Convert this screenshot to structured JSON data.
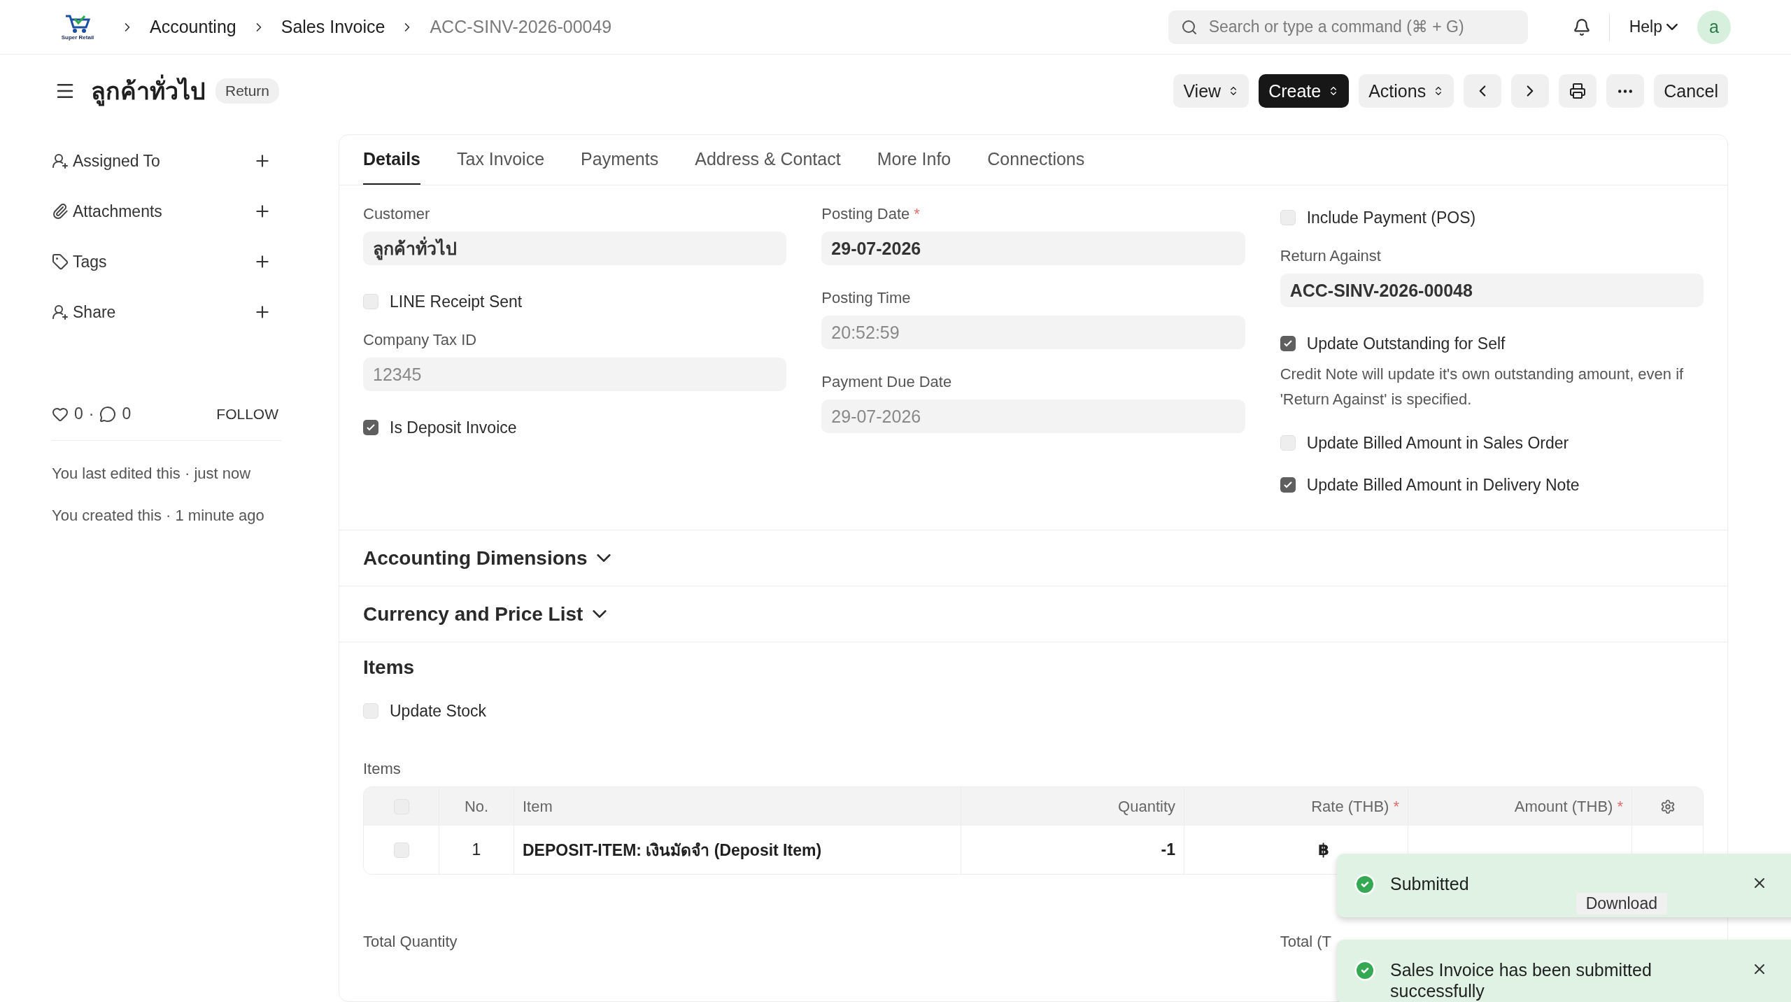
{
  "topbar": {
    "logo_text": "Super Retail",
    "breadcrumbs": [
      "Accounting",
      "Sales Invoice",
      "ACC-SINV-2026-00049"
    ],
    "search": {
      "placeholder": "Search or type a command (⌘ + G)"
    },
    "help": "Help",
    "avatar": "a"
  },
  "required_mark": "*",
  "header": {
    "title": "ลูกค้าทั่วไป",
    "status": "Return",
    "buttons": [
      {
        "kind": "dropdown",
        "label": "View"
      },
      {
        "kind": "primary",
        "label": "Create"
      },
      {
        "kind": "dropdown",
        "label": "Actions"
      },
      {
        "kind": "prev"
      },
      {
        "kind": "next"
      },
      {
        "kind": "print"
      },
      {
        "kind": "more"
      },
      {
        "kind": "plain",
        "label": "Cancel"
      }
    ]
  },
  "sidebar": {
    "items": [
      {
        "kind": "assign",
        "label": "Assigned To"
      },
      {
        "kind": "attach",
        "label": "Attachments"
      },
      {
        "kind": "tag",
        "label": "Tags"
      },
      {
        "kind": "share",
        "label": "Share"
      }
    ],
    "likes": "0",
    "separator": "·",
    "comments": "0",
    "follow": "FOLLOW",
    "activity": [
      "You last edited this · just now",
      "You created this · 1 minute ago"
    ]
  },
  "tabs": [
    {
      "label": "Details",
      "selected": true
    },
    {
      "label": "Tax Invoice",
      "selected": false
    },
    {
      "label": "Payments",
      "selected": false
    },
    {
      "label": "Address & Contact",
      "selected": false
    },
    {
      "label": "More Info",
      "selected": false
    },
    {
      "label": "Connections",
      "selected": false
    }
  ],
  "form": {
    "columns": [
      [
        {
          "kind": "field",
          "label": "Customer",
          "value": "ลูกค้าทั่วไป",
          "required": false,
          "strong": true
        },
        {
          "kind": "check",
          "label": "LINE Receipt Sent",
          "checked": false
        },
        {
          "kind": "field",
          "label": "Company Tax ID",
          "value": "12345",
          "required": false,
          "strong": false
        },
        {
          "kind": "check",
          "label": "Is Deposit Invoice",
          "checked": true
        }
      ],
      [
        {
          "kind": "field",
          "label": "Posting Date",
          "value": "29-07-2026",
          "required": true,
          "strong": true
        },
        {
          "kind": "field",
          "label": "Posting Time",
          "value": "20:52:59",
          "required": false,
          "strong": false
        },
        {
          "kind": "field",
          "label": "Payment Due Date",
          "value": "29-07-2026",
          "required": false,
          "strong": false
        }
      ],
      [
        {
          "kind": "check",
          "label": "Include Payment (POS)",
          "checked": false
        },
        {
          "kind": "field",
          "label": "Return Against",
          "value": "ACC-SINV-2026-00048",
          "required": false,
          "strong": true
        },
        {
          "kind": "check",
          "label": "Update Outstanding for Self",
          "checked": true
        },
        {
          "kind": "note",
          "text": "Credit Note will update it's own outstanding amount, even if 'Return Against' is specified."
        },
        {
          "kind": "check",
          "label": "Update Billed Amount in Sales Order",
          "checked": false
        },
        {
          "kind": "check",
          "label": "Update Billed Amount in Delivery Note",
          "checked": true
        }
      ]
    ]
  },
  "sections": [
    {
      "title": "Accounting Dimensions",
      "expanded": false
    },
    {
      "title": "Currency and Price List",
      "expanded": false
    }
  ],
  "items": {
    "title": "Items",
    "update_stock": {
      "label": "Update Stock",
      "checked": false
    },
    "table_label": "Items",
    "all_checked": false,
    "columns": [
      {
        "label": "No.",
        "required": false
      },
      {
        "label": "Item",
        "required": false
      },
      {
        "label": "Quantity",
        "required": false
      },
      {
        "label": "Rate (THB)",
        "required": true
      },
      {
        "label": "Amount (THB)",
        "required": true
      }
    ],
    "rows": [
      {
        "checked": false,
        "no": "1",
        "item": "DEPOSIT-ITEM: เงินมัดจำ (Deposit Item)",
        "quantity": "-1",
        "rate": "฿"
      }
    ],
    "download": "Download",
    "totals": [
      "Total Quantity",
      "Total (T"
    ]
  },
  "toasts": [
    {
      "message": "Submitted"
    },
    {
      "message": "Sales Invoice has been submitted successfully"
    }
  ]
}
